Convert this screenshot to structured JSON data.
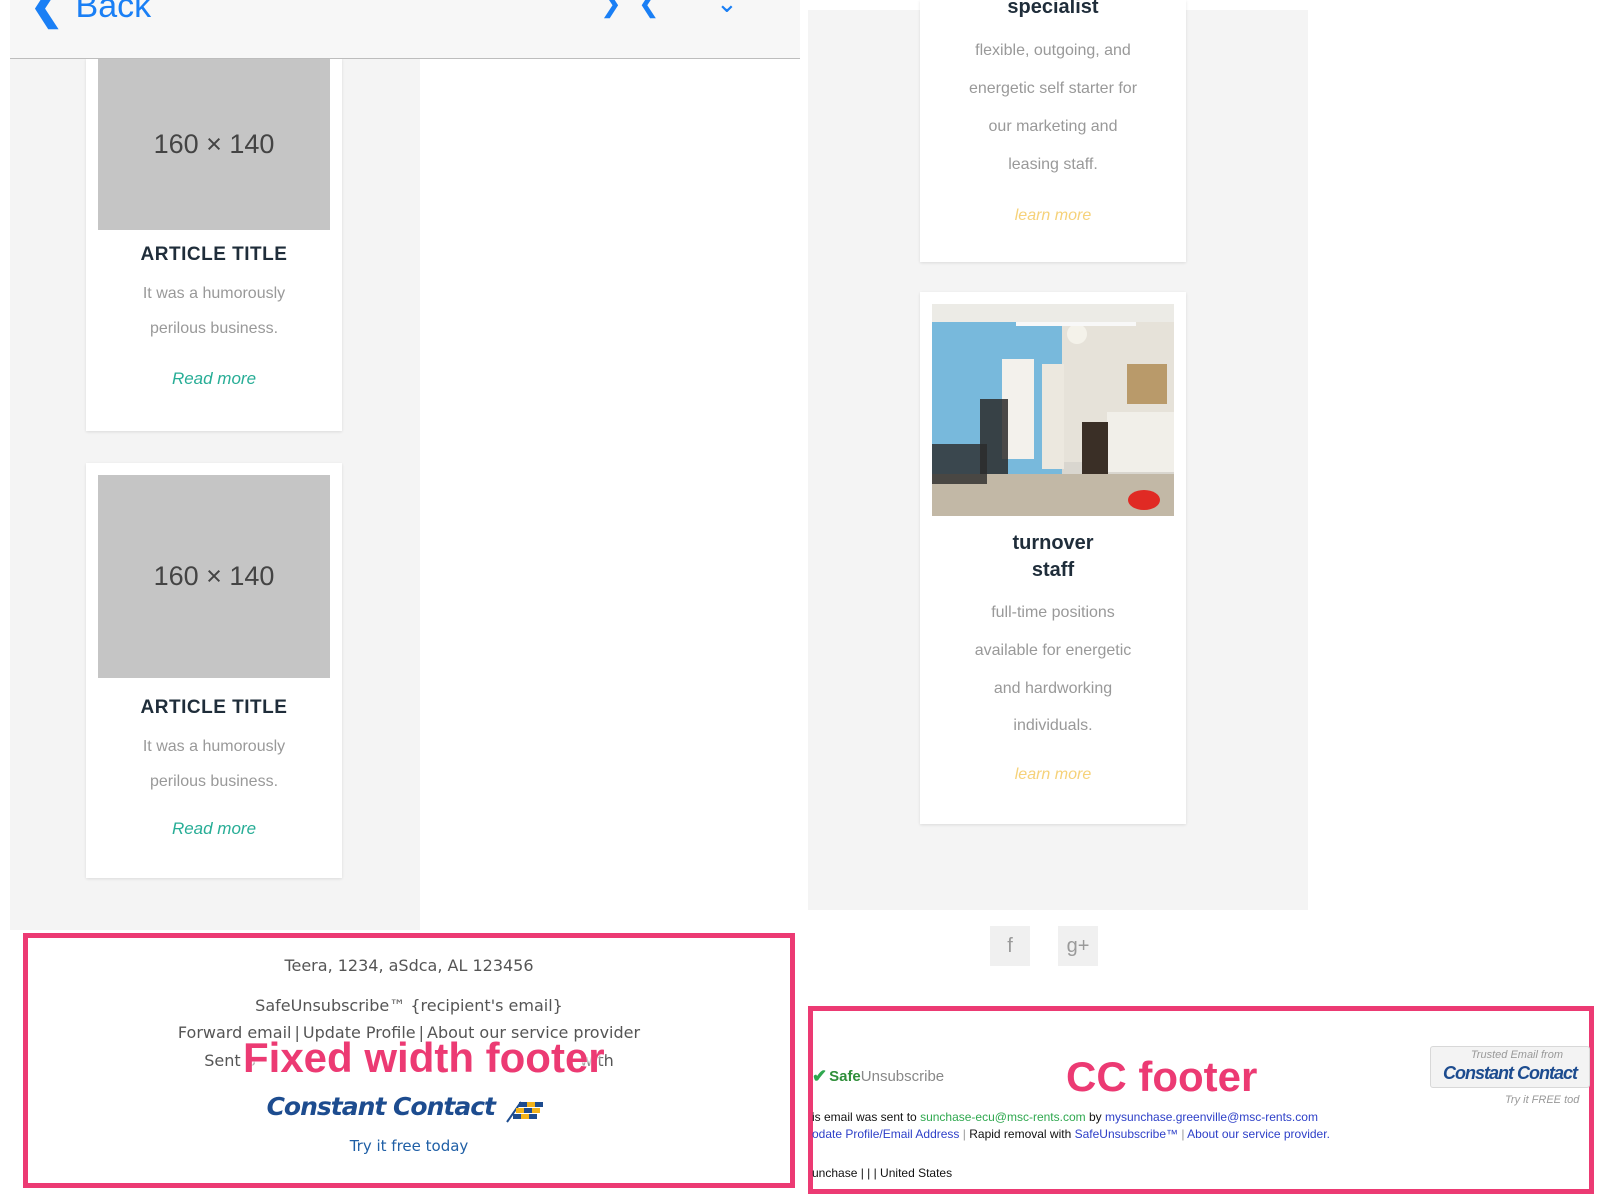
{
  "nav": {
    "back_label": "Back",
    "back_icon": "chevron-left-icon",
    "controls": [
      "chevron-right-icon",
      "chevron-left-icon",
      "chevron-down-icon"
    ]
  },
  "articles": [
    {
      "placeholder": "160 × 140",
      "title": "ARTICLE TITLE",
      "text_lines": [
        "It was a humorously",
        "perilous business."
      ],
      "link": "Read more"
    },
    {
      "placeholder": "160 × 140",
      "title": "ARTICLE TITLE",
      "text_lines": [
        "It was a humorously",
        "perilous business."
      ],
      "link": "Read more"
    }
  ],
  "right_cards": [
    {
      "title": "specialist",
      "text_lines": [
        "flexible, outgoing, and",
        "energetic self starter for",
        "our marketing and",
        "leasing staff."
      ],
      "link": "learn more"
    },
    {
      "title_lines": [
        "turnover",
        "staff"
      ],
      "text_lines": [
        "full-time positions",
        "available for energetic",
        "and hardworking",
        "individuals."
      ],
      "link": "learn more"
    }
  ],
  "social": {
    "facebook": "f",
    "google_plus": "g+"
  },
  "fixed_footer": {
    "label": "Fixed width footer",
    "address": "Teera, 1234, aSdca, AL 123456",
    "safe_unsubscribe": "SafeUnsubscribe™ {recipient's email}",
    "links": [
      "Forward email",
      "Update Profile",
      "About our service provider"
    ],
    "sent_prefix": "Sent b",
    "sent_suffix": "with",
    "brand": "Constant Contact",
    "try_free": "Try it free today"
  },
  "cc_footer": {
    "label": "CC footer",
    "safe_logo_strong": "Safe",
    "safe_logo_rest": "Unsubscribe",
    "sent_line": {
      "prefix": "is email was sent to",
      "recipient": "sunchase-ecu@msc-rents.com",
      "by": "by",
      "sender": "mysunchase.greenville@msc-rents.com"
    },
    "links": [
      "odate Profile/Email Address",
      "About our service provider."
    ],
    "rapid": "Rapid removal with",
    "safe_link": "SafeUnsubscribe™",
    "address": "unchase | | | United States",
    "trusted_line1": "Trusted Email from",
    "trusted_brand": "Constant Contact",
    "trusted_try": "Try it FREE tod"
  },
  "colors": {
    "accent": "#ec3a73",
    "link_teal": "#27ad96",
    "learn_more": "#f6d27a",
    "nav_blue": "#1a7ff5"
  }
}
